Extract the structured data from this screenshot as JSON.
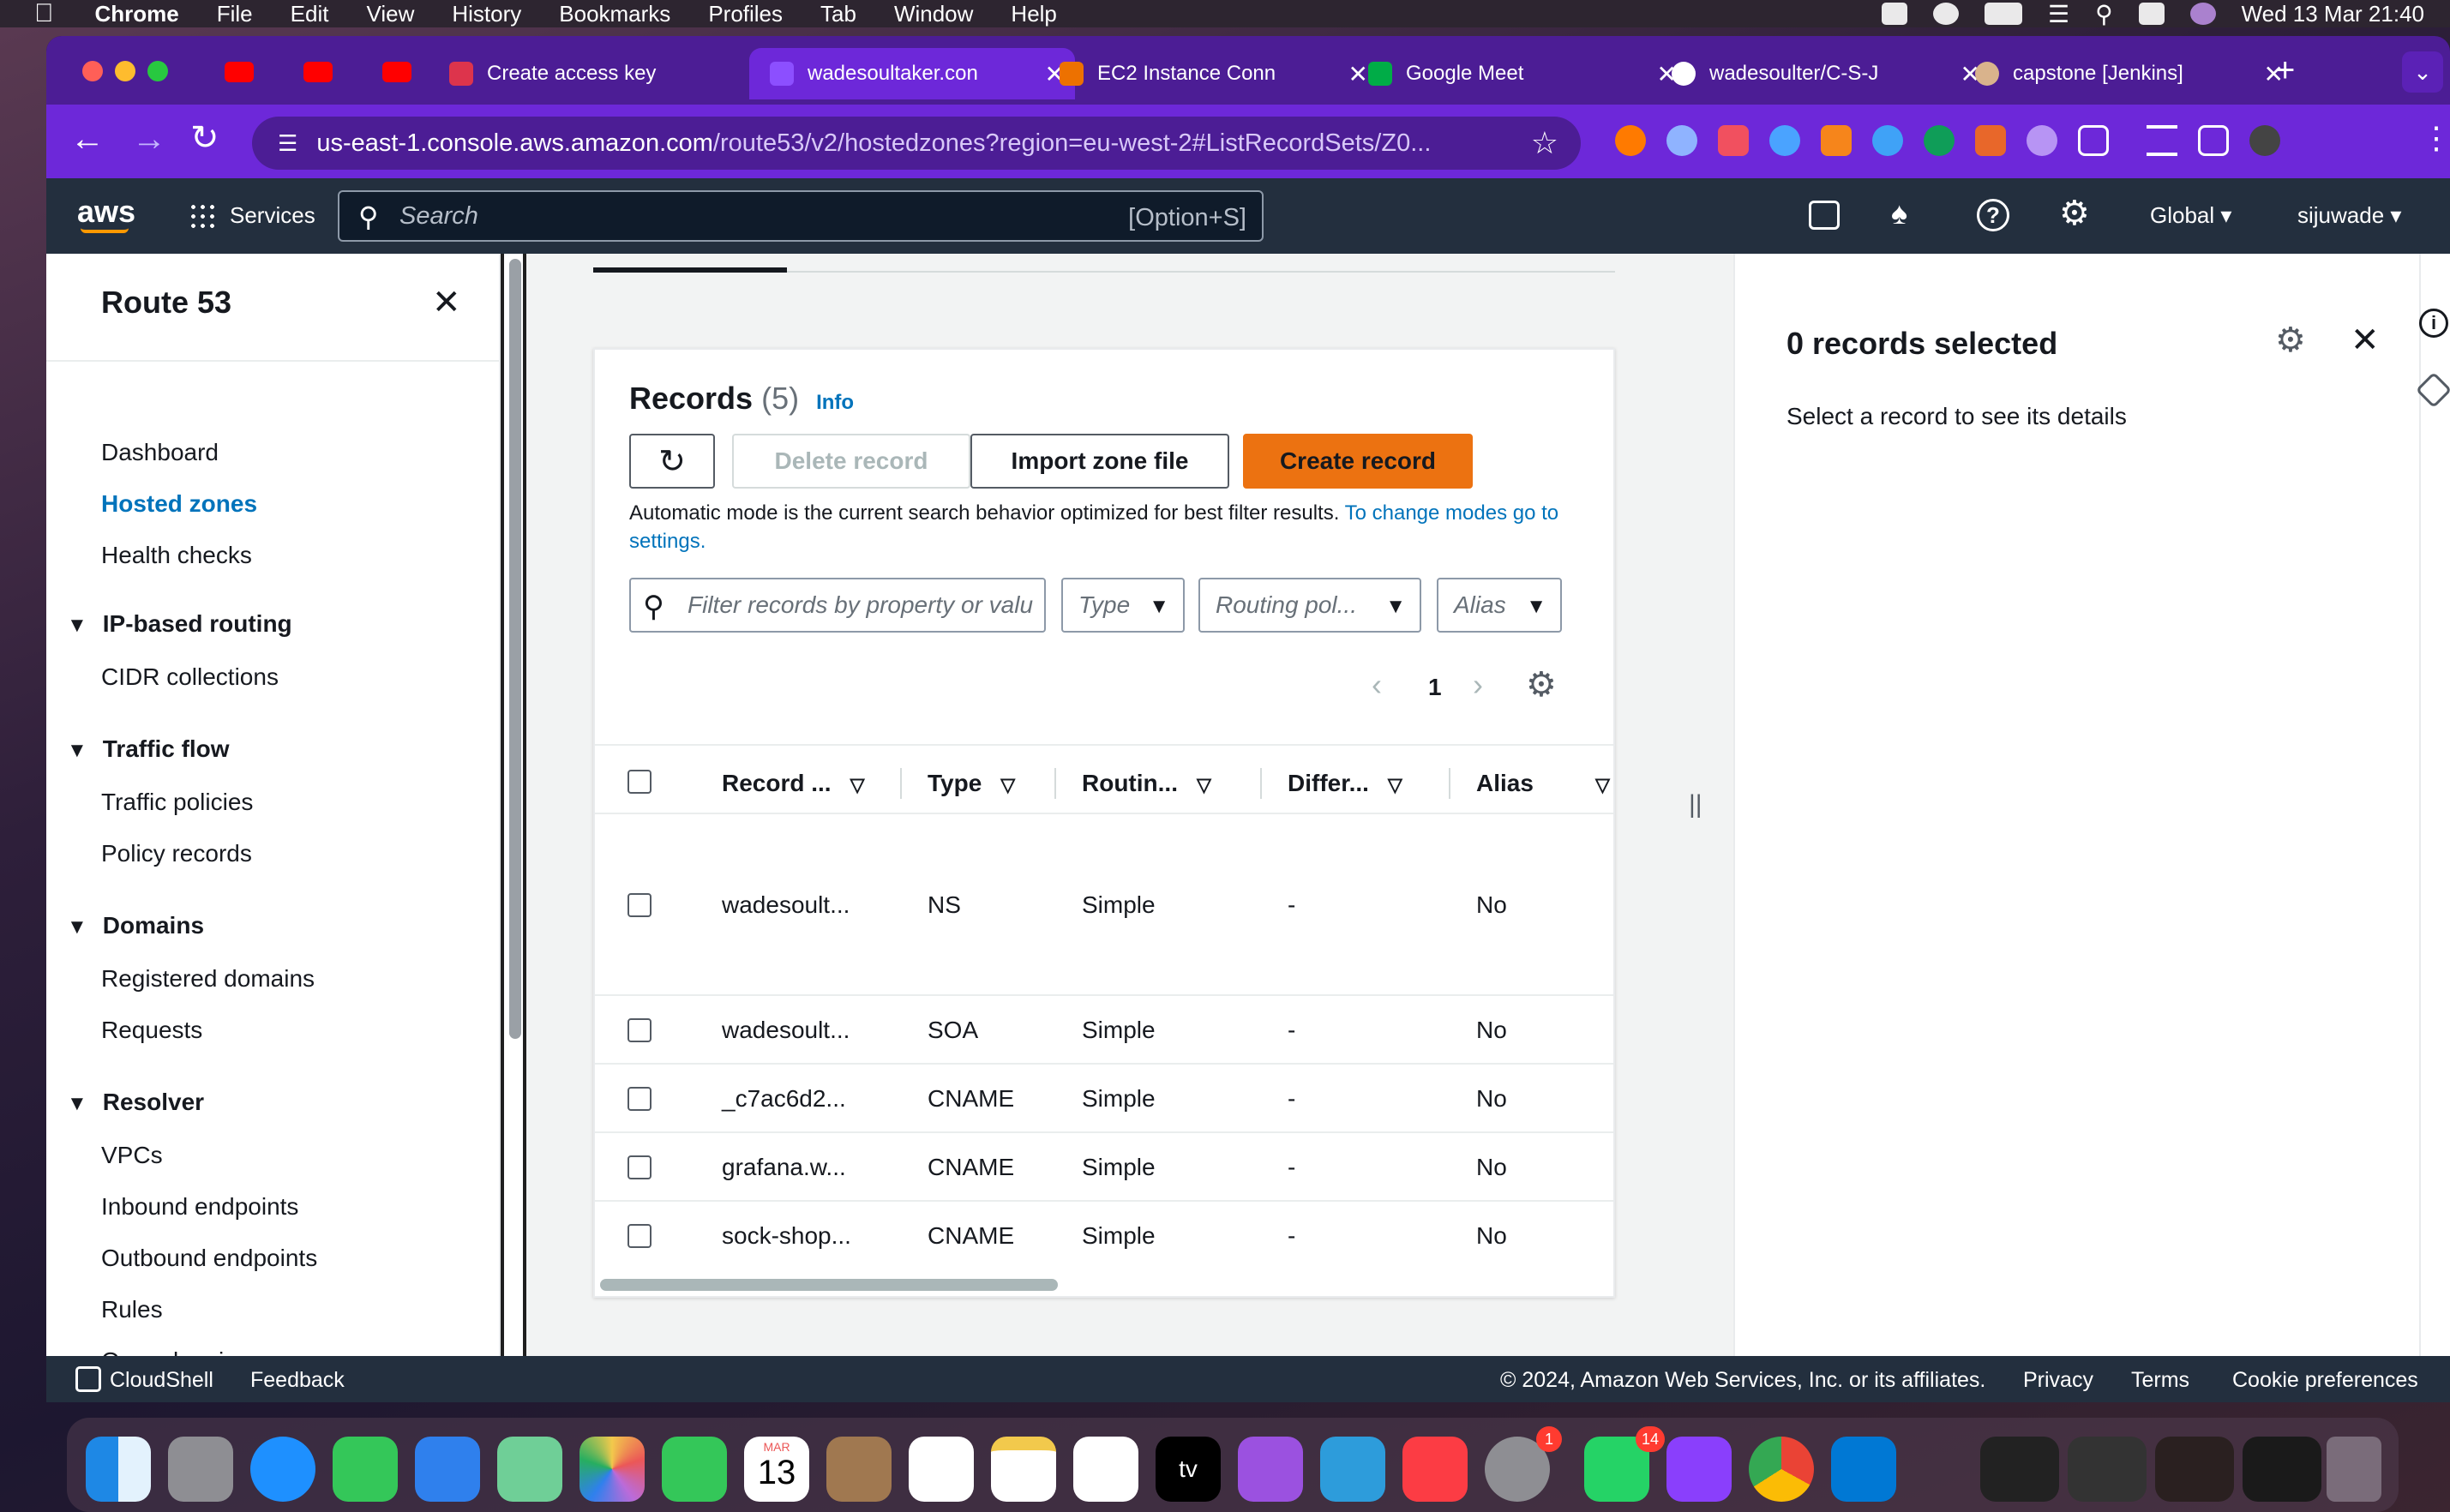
{
  "menubar": {
    "app_name": "Chrome",
    "menus": [
      "File",
      "Edit",
      "View",
      "History",
      "Bookmarks",
      "Profiles",
      "Tab",
      "Window",
      "Help"
    ],
    "datetime": "Wed 13 Mar  21:40"
  },
  "browser": {
    "tabs": [
      {
        "label": "Create access key",
        "icon": "aws-key-icon"
      },
      {
        "label": "wadesoultaker.con",
        "icon": "route53-icon",
        "active": true
      },
      {
        "label": "EC2 Instance Conn",
        "icon": "ec2-icon"
      },
      {
        "label": "Google Meet",
        "icon": "meet-icon"
      },
      {
        "label": "wadesoulter/C-S-J",
        "icon": "github-icon"
      },
      {
        "label": "capstone [Jenkins]",
        "icon": "jenkins-icon"
      }
    ],
    "url_host": "us-east-1.console.aws.amazon.com",
    "url_path": "/route53/v2/hostedzones?region=eu-west-2#ListRecordSets/Z0..."
  },
  "aws_header": {
    "logo": "aws",
    "services_label": "Services",
    "search_placeholder": "Search",
    "search_shortcut": "[Option+S]",
    "region": "Global",
    "user": "sijuwade"
  },
  "sidebar": {
    "title": "Route 53",
    "links_top": [
      "Dashboard",
      "Hosted zones",
      "Health checks"
    ],
    "active": "Hosted zones",
    "sections": [
      {
        "heading": "IP-based routing",
        "items": [
          "CIDR collections"
        ]
      },
      {
        "heading": "Traffic flow",
        "items": [
          "Traffic policies",
          "Policy records"
        ]
      },
      {
        "heading": "Domains",
        "items": [
          "Registered domains",
          "Requests"
        ]
      },
      {
        "heading": "Resolver",
        "items": [
          "VPCs",
          "Inbound endpoints",
          "Outbound endpoints",
          "Rules",
          "Query logging"
        ]
      }
    ]
  },
  "records": {
    "title": "Records",
    "count": "(5)",
    "info_link": "Info",
    "delete_label": "Delete record",
    "import_label": "Import zone file",
    "create_label": "Create record",
    "mode_text": "Automatic mode is the current search behavior optimized for best filter results. ",
    "mode_link": "To change modes go to settings.",
    "filter_placeholder": "Filter records by property or valu",
    "type_filter": "Type",
    "routing_filter": "Routing pol...",
    "alias_filter": "Alias",
    "page": "1",
    "columns": [
      "Record ...",
      "Type",
      "Routin...",
      "Differ...",
      "Alias"
    ],
    "rows": [
      {
        "name": "wadesoult...",
        "type": "NS",
        "routing": "Simple",
        "diff": "-",
        "alias": "No"
      },
      {
        "name": "wadesoult...",
        "type": "SOA",
        "routing": "Simple",
        "diff": "-",
        "alias": "No"
      },
      {
        "name": "_c7ac6d2...",
        "type": "CNAME",
        "routing": "Simple",
        "diff": "-",
        "alias": "No"
      },
      {
        "name": "grafana.w...",
        "type": "CNAME",
        "routing": "Simple",
        "diff": "-",
        "alias": "No"
      },
      {
        "name": "sock-shop...",
        "type": "CNAME",
        "routing": "Simple",
        "diff": "-",
        "alias": "No"
      }
    ]
  },
  "details": {
    "title": "0 records selected",
    "hint": "Select a record to see its details"
  },
  "footer": {
    "cloudshell": "CloudShell",
    "feedback": "Feedback",
    "copyright": "© 2024, Amazon Web Services, Inc. or its affiliates.",
    "privacy": "Privacy",
    "terms": "Terms",
    "cookies": "Cookie preferences"
  },
  "dock": {
    "calendar_month": "MAR",
    "calendar_day": "13",
    "settings_badge": "1",
    "whatsapp_badge": "14",
    "tv_label": "tv"
  },
  "colors": {
    "aws_nav": "#232f3e",
    "aws_orange": "#ec7211",
    "link_blue": "#0073bb",
    "chrome_purple": "#6d28d9"
  }
}
